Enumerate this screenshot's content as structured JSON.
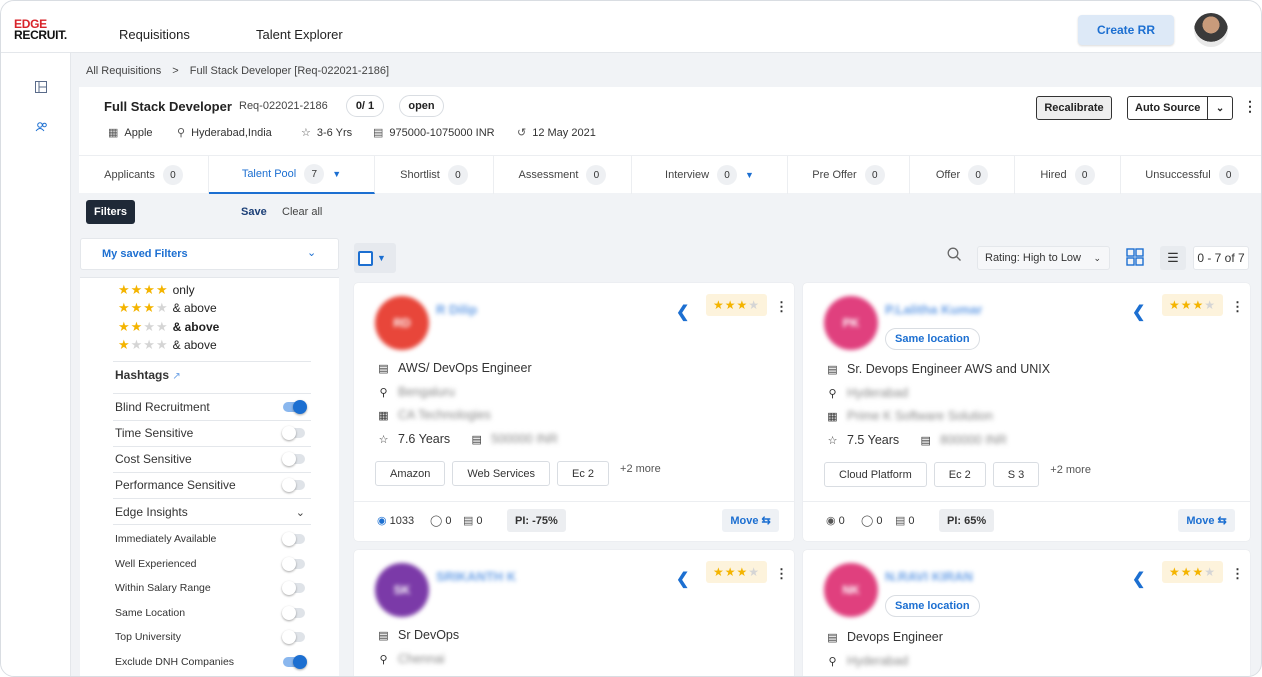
{
  "header": {
    "logo_line1": "EDGE",
    "logo_line2": "RECRUIT.",
    "nav": [
      "Requisitions",
      "Talent Explorer"
    ],
    "create_label": "Create RR"
  },
  "breadcrumb": {
    "root": "All Requisitions",
    "sep": ">",
    "current": "Full Stack Developer [Req-022021-2186]"
  },
  "job": {
    "title": "Full Stack Developer",
    "req_id": "Req-022021-2186",
    "fill_count": "0/ 1",
    "status": "open",
    "company": "Apple",
    "location": "Hyderabad,India",
    "experience": "3-6 Yrs",
    "salary": "975000-1075000 INR",
    "date": "12 May 2021",
    "recalibrate_label": "Recalibrate",
    "auto_source_label": "Auto Source"
  },
  "tabs": [
    {
      "label": "Applicants",
      "count": "0"
    },
    {
      "label": "Talent Pool",
      "count": "7"
    },
    {
      "label": "Shortlist",
      "count": "0"
    },
    {
      "label": "Assessment",
      "count": "0"
    },
    {
      "label": "Interview",
      "count": "0"
    },
    {
      "label": "Pre Offer",
      "count": "0"
    },
    {
      "label": "Offer",
      "count": "0"
    },
    {
      "label": "Hired",
      "count": "0"
    },
    {
      "label": "Unsuccessful",
      "count": "0"
    }
  ],
  "filters": {
    "button_label": "Filters",
    "save_label": "Save",
    "clear_label": "Clear all",
    "saved_filters_label": "My saved Filters",
    "ratings": [
      {
        "stars": 4,
        "label": "only"
      },
      {
        "stars": 3,
        "label": "& above"
      },
      {
        "stars": 2,
        "label": "& above"
      },
      {
        "stars": 1,
        "label": "& above"
      }
    ],
    "hashtags_label": "Hashtags",
    "hashtag_toggles": [
      {
        "label": "Blind Recruitment",
        "on": true
      },
      {
        "label": "Time Sensitive",
        "on": false
      },
      {
        "label": "Cost Sensitive",
        "on": false
      },
      {
        "label": "Performance Sensitive",
        "on": false
      }
    ],
    "insights_label": "Edge Insights",
    "insight_toggles": [
      {
        "label": "Immediately Available",
        "on": false
      },
      {
        "label": "Well Experienced",
        "on": false
      },
      {
        "label": "Within Salary Range",
        "on": false
      },
      {
        "label": "Same Location",
        "on": false
      },
      {
        "label": "Top University",
        "on": false
      },
      {
        "label": "Exclude DNH Companies",
        "on": true
      }
    ]
  },
  "results": {
    "sort_label": "Rating: High to Low",
    "pager": "0 - 7 of 7"
  },
  "candidates": [
    {
      "initials": "RD",
      "name": "R Dilip",
      "avatar_color": "#e8463a",
      "same_location": "",
      "rating": 3,
      "title": "AWS/ DevOps Engineer",
      "location": "Bengaluru",
      "company": "CA Technologies",
      "experience": "7.6 Years",
      "salary": "500000 INR",
      "skills": [
        "Amazon",
        "Web Services",
        "Ec 2"
      ],
      "more": "+2 more",
      "views": "1033",
      "comments": "0",
      "jobs": "0",
      "pi": "PI: -75%",
      "move_label": "Move"
    },
    {
      "initials": "PK",
      "name": "P.Lalitha Kumar",
      "avatar_color": "#e0407e",
      "same_location": "Same location",
      "rating": 3,
      "title": "Sr. Devops Engineer AWS and UNIX",
      "location": "Hyderabad",
      "company": "Prime K Software Solution",
      "experience": "7.5 Years",
      "salary": "800000 INR",
      "skills": [
        "Cloud Platform",
        "Ec 2",
        "S 3"
      ],
      "more": "+2 more",
      "views": "0",
      "comments": "0",
      "jobs": "0",
      "pi": "PI: 65%",
      "move_label": "Move"
    },
    {
      "initials": "SK",
      "name": "SRIKANTH K",
      "avatar_color": "#7b3aa8",
      "same_location": "",
      "rating": 3,
      "title": "Sr DevOps",
      "location": "Chennai",
      "company": "",
      "experience": "",
      "salary": "",
      "skills": [],
      "more": "",
      "views": "",
      "comments": "",
      "jobs": "",
      "pi": "",
      "move_label": ""
    },
    {
      "initials": "NK",
      "name": "N.RAVI KIRAN",
      "avatar_color": "#e0407e",
      "same_location": "Same location",
      "rating": 3,
      "title": "Devops Engineer",
      "location": "Hyderabad",
      "company": "",
      "experience": "",
      "salary": "",
      "skills": [],
      "more": "",
      "views": "",
      "comments": "",
      "jobs": "",
      "pi": "",
      "move_label": ""
    }
  ]
}
